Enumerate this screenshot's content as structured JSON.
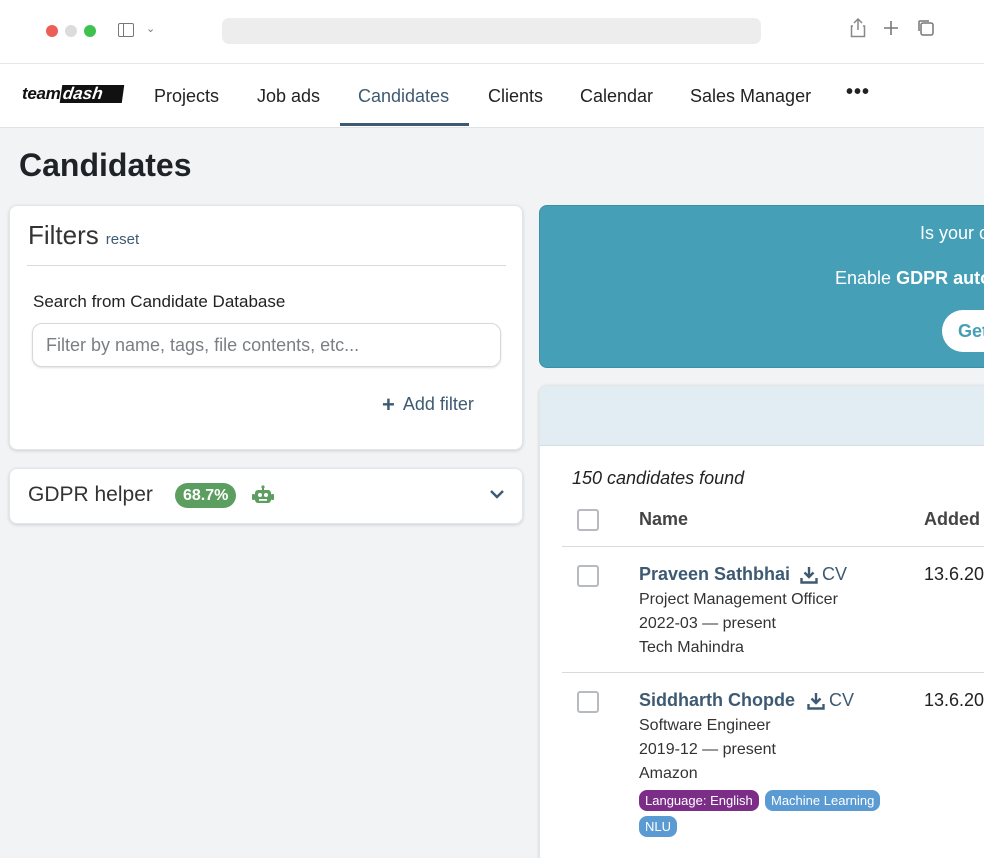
{
  "browser": {
    "address_bar": ""
  },
  "nav": {
    "logo_team": "team",
    "logo_dash": "dash",
    "items": [
      "Projects",
      "Job ads",
      "Candidates",
      "Clients",
      "Calendar",
      "Sales Manager"
    ],
    "active": "Candidates",
    "more": "•••"
  },
  "page": {
    "title": "Candidates"
  },
  "filters": {
    "title": "Filters",
    "reset": "reset",
    "search_label": "Search from Candidate Database",
    "search_placeholder": "Filter by name, tags, file contents, etc...",
    "search_value": "",
    "add_filter": "Add filter"
  },
  "gdpr": {
    "title": "GDPR helper",
    "percent": "68.7%"
  },
  "banner": {
    "line1": "Is your c",
    "line2_prefix": "Enable ",
    "line2_bold": "GDPR auto",
    "button": "Get"
  },
  "candidates": {
    "found": "150 candidates found",
    "col_name": "Name",
    "col_added": "Added",
    "rows": [
      {
        "name": "Praveen Sathbhai",
        "cv": "CV",
        "title": "Project Management Officer",
        "period": "2022-03 — present",
        "company": "Tech Mahindra",
        "added": "13.6.20",
        "tags": []
      },
      {
        "name": "Siddharth Chopde",
        "cv": "CV",
        "title": "Software Engineer",
        "period": "2019-12 — present",
        "company": "Amazon",
        "added": "13.6.20",
        "tags": [
          {
            "label": "Language: English",
            "color": "#7b2d88"
          },
          {
            "label": "Machine Learning",
            "color": "#5b9bd3"
          },
          {
            "label": "NLU",
            "color": "#5b9bd3"
          }
        ]
      }
    ]
  },
  "colors": {
    "accent": "#3e5a72",
    "banner": "#449fb7",
    "gdpr_badge": "#5b9e5f"
  }
}
